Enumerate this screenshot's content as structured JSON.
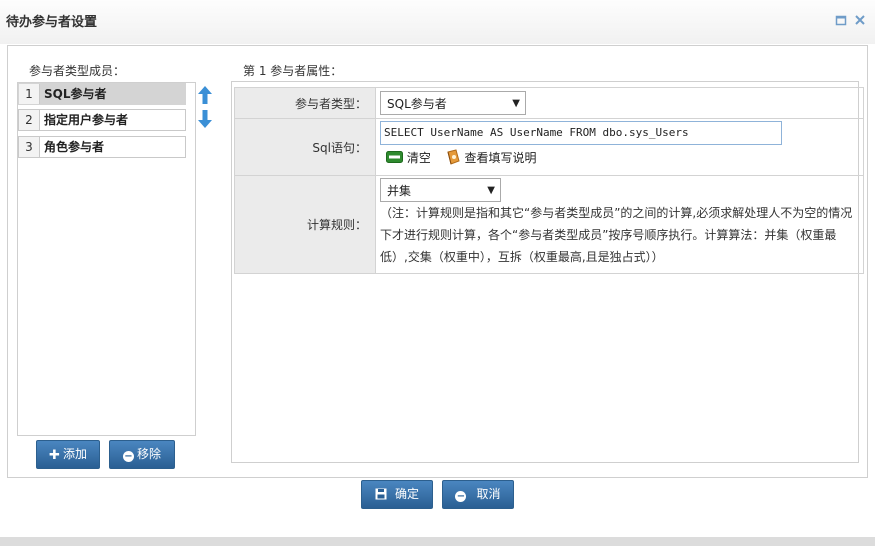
{
  "window": {
    "title": "待办参与者设置",
    "maximize_icon": "maximize-icon",
    "close_icon": "close-icon"
  },
  "member_list": {
    "header": "参与者类型成员：",
    "items": [
      {
        "num": "1",
        "label": "SQL参与者",
        "selected": true
      },
      {
        "num": "2",
        "label": "指定用户参与者",
        "selected": false
      },
      {
        "num": "3",
        "label": "角色参与者",
        "selected": false
      }
    ],
    "move_up_icon": "arrow-up-icon",
    "move_down_icon": "arrow-down-icon",
    "add_label": "添加",
    "remove_label": "移除"
  },
  "properties": {
    "header": "第 1 参与者属性：",
    "type_label": "参与者类型：",
    "type_value": "SQL参与者",
    "sql_label": "Sql语句：",
    "sql_value": "SELECT UserName AS UserName FROM dbo.sys_Users",
    "clear_label": "清空",
    "help_label": "查看填写说明",
    "rule_label": "计算规则：",
    "rule_value": "并集",
    "rule_note": "（注：计算规则是指和其它“参与者类型成员”的之间的计算,必须求解处理人不为空的情况下才进行规则计算，各个“参与者类型成员”按序号顺序执行。计算算法：并集（权重最低）,交集（权重中），互拆（权重最高,且是独占式））"
  },
  "footer": {
    "ok_label": "确定",
    "cancel_label": "取消"
  },
  "colors": {
    "button_blue": "#2a5f93",
    "arrow_blue": "#3a8fd6",
    "selected_item": "#d4d4d4"
  }
}
